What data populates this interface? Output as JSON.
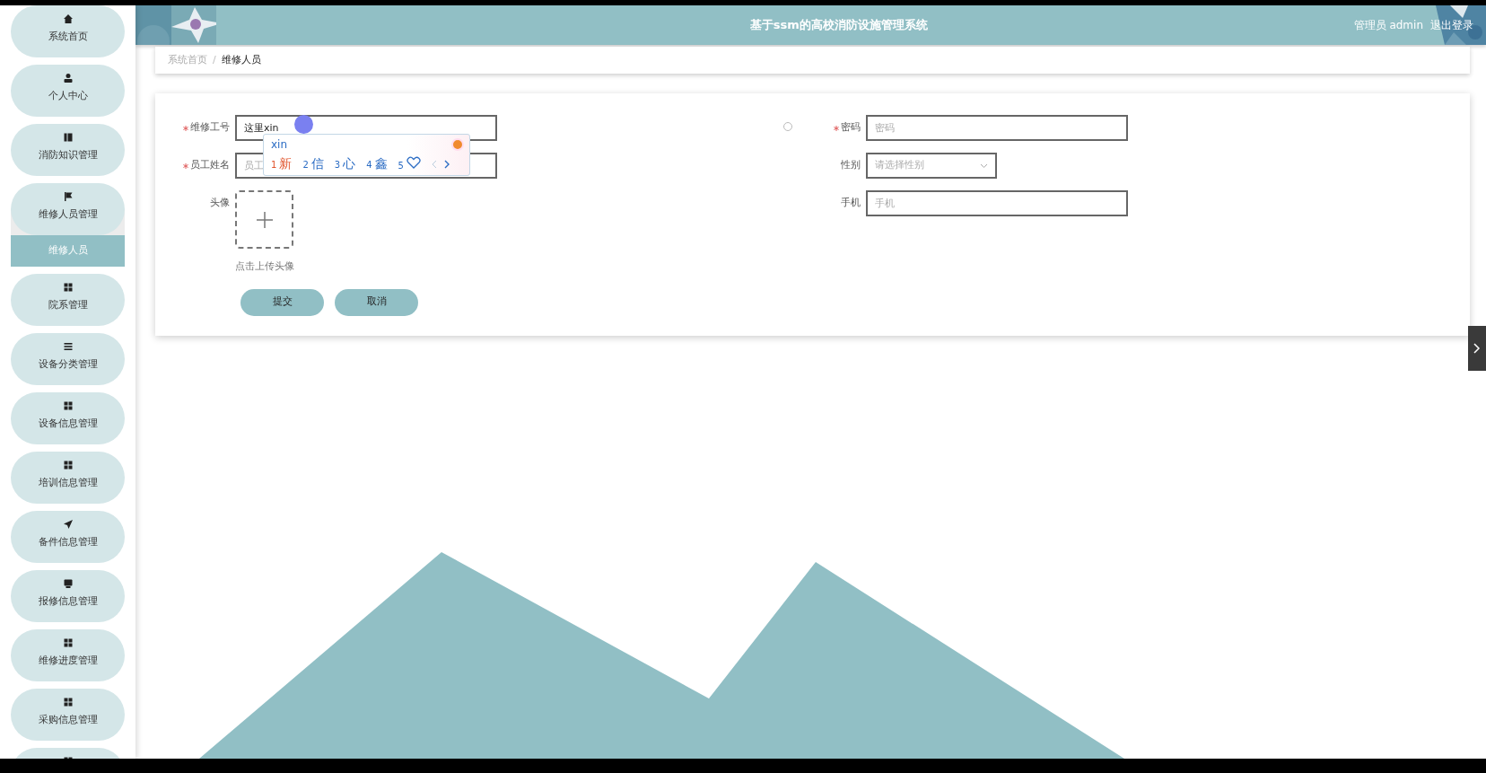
{
  "sidebar": {
    "items": [
      {
        "kind": "home",
        "label": "系统首页",
        "expanded": false
      },
      {
        "kind": "user",
        "label": "个人中心",
        "expanded": false
      },
      {
        "kind": "book",
        "label": "消防知识管理",
        "expanded": false
      },
      {
        "kind": "flag",
        "label": "维修人员管理",
        "expanded": true,
        "children": [
          {
            "label": "维修人员",
            "selected": true
          }
        ]
      },
      {
        "kind": "grid",
        "label": "院系管理",
        "expanded": false
      },
      {
        "kind": "list",
        "label": "设备分类管理",
        "expanded": false
      },
      {
        "kind": "grid",
        "label": "设备信息管理",
        "expanded": false
      },
      {
        "kind": "grid",
        "label": "培训信息管理",
        "expanded": false
      },
      {
        "kind": "plane",
        "label": "备件信息管理",
        "expanded": false
      },
      {
        "kind": "monitor",
        "label": "报修信息管理",
        "expanded": false
      },
      {
        "kind": "grid",
        "label": "维修进度管理",
        "expanded": false
      },
      {
        "kind": "grid",
        "label": "采购信息管理",
        "expanded": false
      },
      {
        "kind": "grid",
        "expanded": false
      }
    ]
  },
  "header": {
    "title": "基于ssm的高校消防设施管理系统",
    "user": "管理员 admin",
    "logout": "退出登录"
  },
  "breadcrumb": [
    {
      "label": "系统首页",
      "current": false
    },
    {
      "separator": "/",
      "label": "维修人员",
      "current": true
    }
  ],
  "form": {
    "left": [
      {
        "kind": "text",
        "label": "维修工号",
        "required": true,
        "value": "这里xin"
      },
      {
        "kind": "text",
        "label": "员工姓名",
        "required": true,
        "placeholder": "员工"
      },
      {
        "kind": "upload",
        "label": "头像",
        "required": false,
        "hint": "点击上传头像"
      }
    ],
    "right": [
      {
        "kind": "text",
        "label": "密码",
        "required": true,
        "placeholder": "密码"
      },
      {
        "kind": "select",
        "label": "性别",
        "required": false,
        "placeholder": "请选择性别"
      },
      {
        "kind": "text",
        "label": "手机",
        "required": false,
        "placeholder": "手机"
      }
    ],
    "buttons": [
      "提交",
      "取消"
    ]
  },
  "ime": {
    "composition": "xin",
    "candidates": [
      {
        "number": "1",
        "kind": "char",
        "text": "新",
        "highlighted": true
      },
      {
        "number": "2",
        "kind": "char",
        "text": "信",
        "highlighted": false
      },
      {
        "number": "3",
        "kind": "char",
        "text": "心",
        "highlighted": false
      },
      {
        "number": "4",
        "kind": "char",
        "text": "鑫",
        "highlighted": false
      },
      {
        "number": "5",
        "kind": "heart",
        "highlighted": false
      }
    ]
  }
}
